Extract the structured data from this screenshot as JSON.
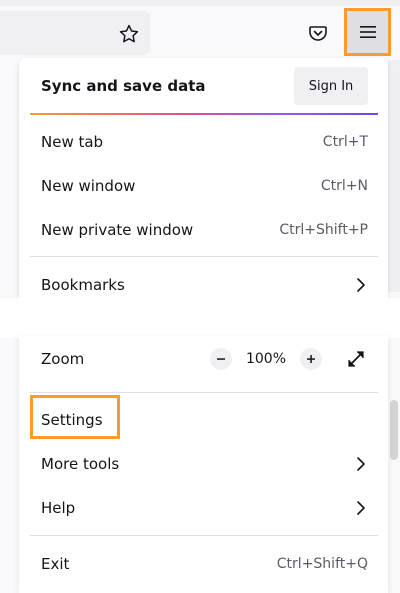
{
  "menu": {
    "sync_title": "Sync and save data",
    "sign_in_label": "Sign In",
    "new_tab": {
      "label": "New tab",
      "shortcut": "Ctrl+T"
    },
    "new_window": {
      "label": "New window",
      "shortcut": "Ctrl+N"
    },
    "new_private_window": {
      "label": "New private window",
      "shortcut": "Ctrl+Shift+P"
    },
    "bookmarks": {
      "label": "Bookmarks"
    },
    "zoom": {
      "label": "Zoom",
      "value": "100%"
    },
    "settings": {
      "label": "Settings"
    },
    "more_tools": {
      "label": "More tools"
    },
    "help": {
      "label": "Help"
    },
    "exit": {
      "label": "Exit",
      "shortcut": "Ctrl+Shift+Q"
    }
  },
  "icons": {
    "bookmark_star": "star-icon",
    "pocket": "pocket-icon",
    "app_menu": "hamburger-icon",
    "submenu": "chevron-right-icon",
    "zoom_out": "minus-icon",
    "zoom_in": "plus-icon",
    "fullscreen": "fullscreen-icon"
  },
  "colors": {
    "highlight": "#ff9a2e",
    "gradient_start": "#ff9a2e",
    "gradient_mid": "#e24d8a",
    "gradient_end": "#7542e5",
    "panel_bg": "#ffffff",
    "toolbar_bg": "#f9f9fb"
  }
}
